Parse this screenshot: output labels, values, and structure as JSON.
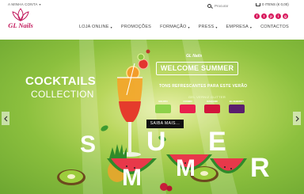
{
  "topbar": {
    "account_label": "A MINHA CONTA",
    "search_placeholder": "Procurar",
    "cart_text": "0 ITENS (€ 0,00)"
  },
  "social": [
    "f",
    "t",
    "p",
    "i",
    "g"
  ],
  "logo": {
    "name": "GL Nails"
  },
  "nav": [
    {
      "label": "LOJA ONLINE",
      "dropdown": true
    },
    {
      "label": "PROMOÇÕES",
      "dropdown": false
    },
    {
      "label": "FORMAÇÃO",
      "dropdown": true
    },
    {
      "label": "PRESS",
      "dropdown": true
    },
    {
      "label": "EMPRESA",
      "dropdown": true
    },
    {
      "label": "CONTACTOS",
      "dropdown": false
    }
  ],
  "hero": {
    "brand_small": "GL Nails",
    "welcome": "WELCOME SUMMER",
    "tagline": "TONS REFRESCANTES PARA ESTE VERÃO",
    "glitter": "GEL VERNIZ GLITTER",
    "cocktails": "COCKTAILS",
    "collection": "COLLECTION",
    "cta": "SAIBA MAIS...",
    "summer_letters": [
      "S",
      "U",
      "M",
      "M",
      "E",
      "R"
    ],
    "swatches": [
      {
        "label": "MOJITO",
        "code": "",
        "color": "#8ed14a"
      },
      {
        "label": "COSMO",
        "code": "",
        "color": "#e8204d"
      },
      {
        "label": "DAIQUIRI",
        "code": "",
        "color": "#d2143c"
      },
      {
        "label": "BLUEBERRY",
        "code": "",
        "color": "#5a1e6e"
      }
    ]
  },
  "colors": {
    "brand": "#c2185b",
    "hero_green": "#8cc03e"
  }
}
